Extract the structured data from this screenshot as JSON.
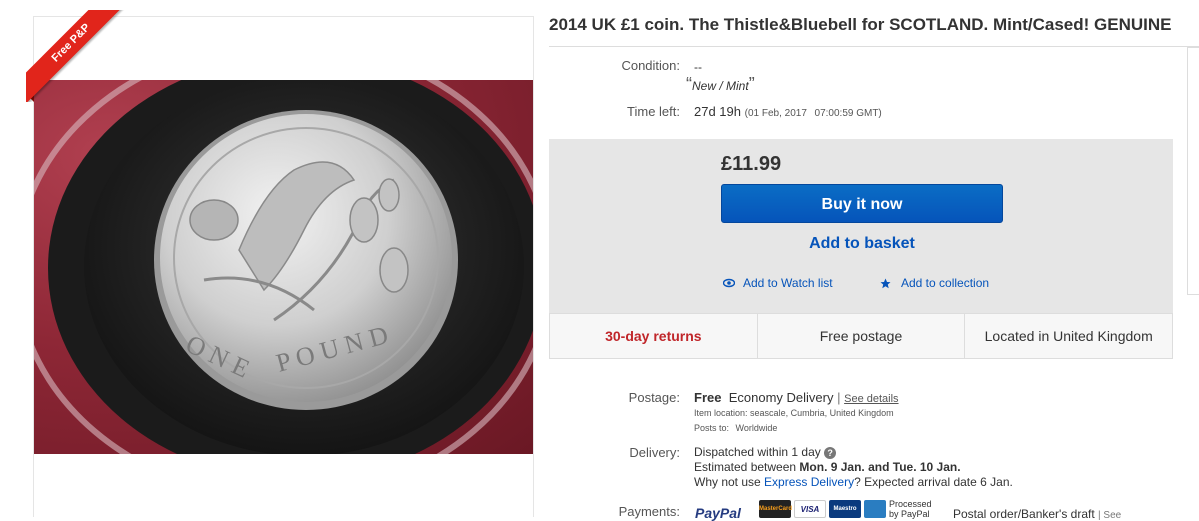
{
  "image_panel": {
    "ribbon_text": "Free P&P",
    "coin": {
      "text_one": "O N E",
      "text_pound": "P O U N D"
    }
  },
  "listing": {
    "title": "2014 UK £1 coin. The Thistle&Bluebell for SCOTLAND. Mint/Cased! GENUINE",
    "condition_label": "Condition:",
    "condition_value": "--",
    "condition_quote": "New / Mint",
    "time_left_label": "Time left:",
    "time_left_value": "27d 19h",
    "time_left_date": "(01 Feb, 2017",
    "time_left_time": "07:00:59 GMT)"
  },
  "buy_box": {
    "price": "£11.99",
    "buy_now_label": "Buy it now",
    "add_basket_label": "Add to basket",
    "watch_label": "Add to Watch list",
    "collection_label": "Add to collection"
  },
  "info_bar": {
    "returns": "30-day returns",
    "postage": "Free postage",
    "location": "Located in United Kingdom"
  },
  "postage": {
    "label": "Postage:",
    "free": "Free",
    "service": "Economy Delivery",
    "separator": "|",
    "see_details": "See details",
    "item_location_label": "Item location:",
    "item_location": "seascale, Cumbria, United Kingdom",
    "posts_to_label": "Posts to:",
    "posts_to": "Worldwide"
  },
  "delivery": {
    "label": "Delivery:",
    "dispatch": "Dispatched within 1 day",
    "estimated_prefix": "Estimated between",
    "estimated_range": "Mon. 9 Jan. and Tue. 10 Jan.",
    "why_prefix": "Why not use",
    "express_link": "Express Delivery",
    "why_suffix": "? Expected arrival date 6 Jan."
  },
  "payments": {
    "label": "Payments:",
    "paypal": "PayPal",
    "mastercard": "MasterCard",
    "visa": "VISA",
    "maestro": "Maestro",
    "processed_1": "Processed",
    "processed_2": "by PayPal",
    "other": "Postal order/Banker's draft",
    "see": "| See"
  },
  "colors": {
    "accent_blue": "#0654ba",
    "returns_red": "#c0262a",
    "ribbon_red": "#e1251b"
  }
}
